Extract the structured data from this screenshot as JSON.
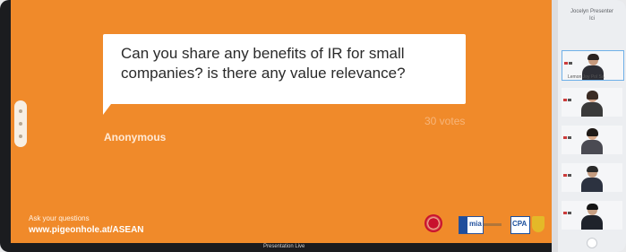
{
  "slide": {
    "question": "Can you share any benefits of IR for small companies? is there any value relevance?",
    "votes": "30 votes",
    "author": "Anonymous",
    "prompt": "Ask your questions",
    "url": "www.pigeonhole.at/ASEAN",
    "logos": [
      {
        "name": "red-emblem-logo"
      },
      {
        "name": "mia-logo",
        "text": "mia"
      },
      {
        "name": "cpa-logo",
        "text": "CPA"
      },
      {
        "name": "crest-logo"
      }
    ]
  },
  "bottom_bar": {
    "label": "Presentation Live"
  },
  "participants": {
    "title": "Jocelyn Presenter",
    "subtitle": "Ici",
    "tiles": [
      {
        "name": "Lemon Joy Pol Sa",
        "active": true
      },
      {
        "name": "",
        "active": false
      },
      {
        "name": "",
        "active": false
      },
      {
        "name": "",
        "active": false
      },
      {
        "name": "",
        "active": false
      }
    ]
  },
  "colors": {
    "slide_background": "#f08a2a",
    "bubble": "#ffffff",
    "text_dark": "#2a2a2a"
  }
}
